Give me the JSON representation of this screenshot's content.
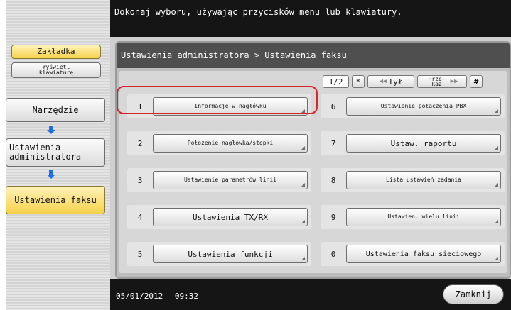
{
  "top_message": "Dokonaj wyboru, używając przycisków menu lub klawiatury.",
  "sidebar": {
    "tab_label": "Zakładka",
    "keyboard_label": "Wyświetl klawiaturę",
    "nav": [
      {
        "label": "Narzędzie"
      },
      {
        "label": "Ustawienia administratora"
      },
      {
        "label": "Ustawienia faksu"
      }
    ]
  },
  "panel": {
    "breadcrumb": "Ustawienia administratora  > Ustawienia faksu",
    "pager": {
      "page": "1/2",
      "star": "*",
      "back": "Tył",
      "next": "Prze- każ",
      "hash": "#"
    }
  },
  "options": [
    {
      "num": "1",
      "label": "Informacje w nagłówku"
    },
    {
      "num": "2",
      "label": "Położenie nagłówka/stopki"
    },
    {
      "num": "3",
      "label": "Ustawienie parametrów linii"
    },
    {
      "num": "4",
      "label": "Ustawienia TX/RX"
    },
    {
      "num": "5",
      "label": "Ustawienia funkcji"
    },
    {
      "num": "6",
      "label": "Ustawienie połączenia PBX"
    },
    {
      "num": "7",
      "label": "Ustaw. raportu"
    },
    {
      "num": "8",
      "label": "Lista ustawień zadania"
    },
    {
      "num": "9",
      "label": "Ustawien. wielu linii"
    },
    {
      "num": "0",
      "label": "Ustawienia faksu sieciowego"
    }
  ],
  "footer": {
    "date": "05/01/2012",
    "time": "09:32",
    "close_label": "Zamknij"
  },
  "colors": {
    "highlight": "#d8232a",
    "arrow": "#1f6fe0",
    "selected": "#f5d24c"
  }
}
